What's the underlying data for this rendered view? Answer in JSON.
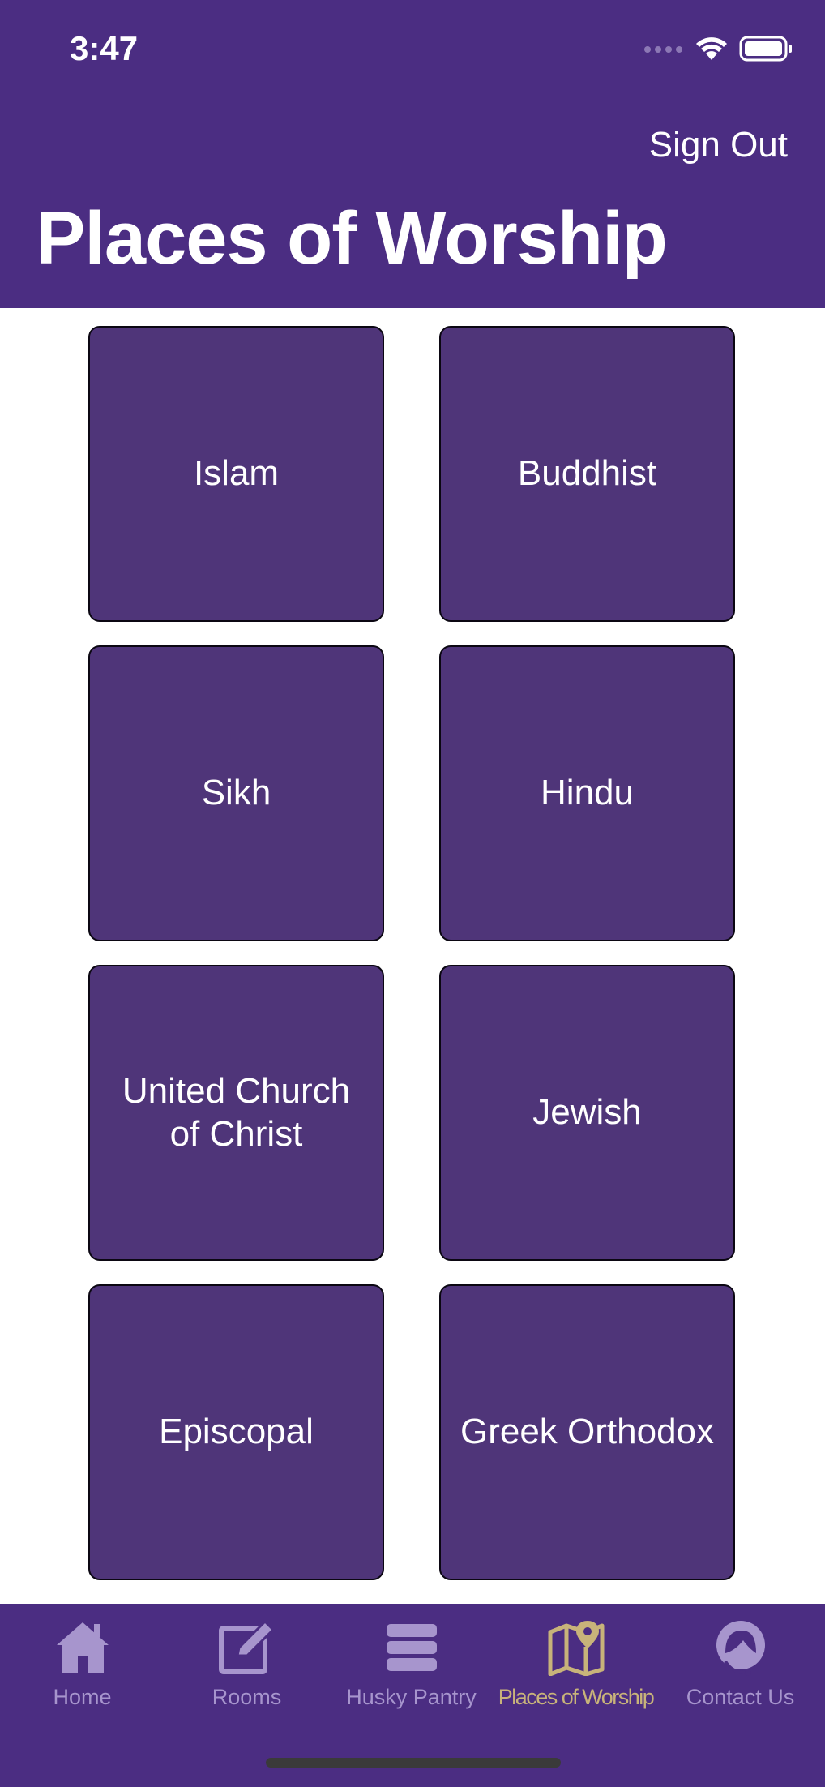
{
  "status_bar": {
    "time": "3:47"
  },
  "header": {
    "sign_out_label": "Sign Out",
    "title": "Places of Worship"
  },
  "tiles": [
    {
      "label": "Islam"
    },
    {
      "label": "Buddhist"
    },
    {
      "label": "Sikh"
    },
    {
      "label": "Hindu"
    },
    {
      "label": "United Church of Christ"
    },
    {
      "label": "Jewish"
    },
    {
      "label": "Episcopal"
    },
    {
      "label": "Greek Orthodox"
    }
  ],
  "tab_bar": {
    "tabs": [
      {
        "label": "Home",
        "icon": "house-icon",
        "active": false
      },
      {
        "label": "Rooms",
        "icon": "edit-icon",
        "active": false
      },
      {
        "label": "Husky Pantry",
        "icon": "stack-icon",
        "active": false
      },
      {
        "label": "Places of Worship",
        "icon": "map-pin-icon",
        "active": true
      },
      {
        "label": "Contact Us",
        "icon": "headset-icon",
        "active": false
      }
    ]
  },
  "colors": {
    "header_purple": "#4b2d82",
    "tile_purple": "#4f3579",
    "tab_inactive": "#a795cd",
    "tab_active": "#c8b37a"
  }
}
